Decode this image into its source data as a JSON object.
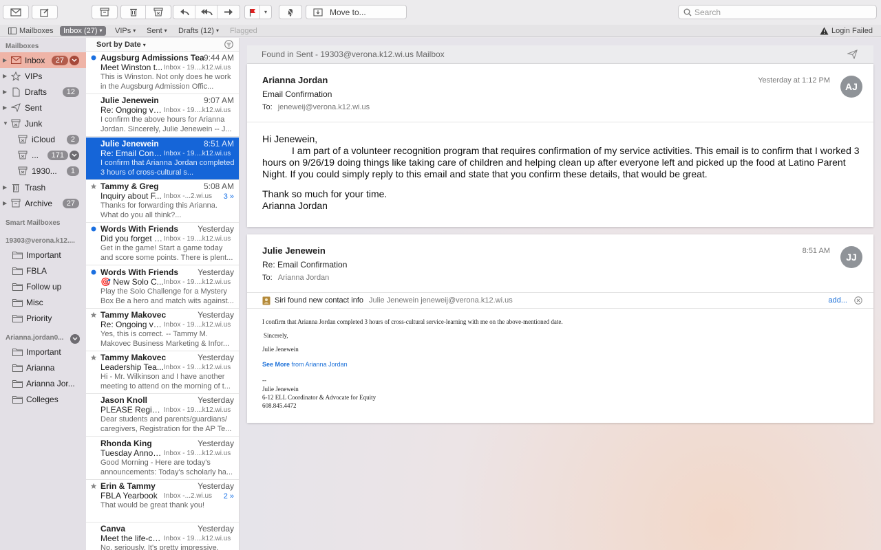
{
  "toolbar": {
    "move_to": "Move to...",
    "search_placeholder": "Search"
  },
  "favorites": {
    "mailboxes": "Mailboxes",
    "inbox": "Inbox (27)",
    "vips": "VIPs",
    "sent": "Sent",
    "drafts": "Drafts (12)",
    "flagged": "Flagged",
    "login_failed": "Login Failed"
  },
  "sidebar": {
    "header_mailboxes": "Mailboxes",
    "inbox": {
      "label": "Inbox",
      "count": "27"
    },
    "vips": {
      "label": "VIPs"
    },
    "drafts": {
      "label": "Drafts",
      "count": "12"
    },
    "sent": {
      "label": "Sent"
    },
    "junk": {
      "label": "Junk"
    },
    "junk_icloud": {
      "label": "iCloud",
      "count": "2"
    },
    "junk_ellipsis": {
      "label": "...",
      "count": "171"
    },
    "junk_1930": {
      "label": "1930...",
      "count": "1"
    },
    "trash": {
      "label": "Trash"
    },
    "archive": {
      "label": "Archive",
      "count": "27"
    },
    "header_smart": "Smart Mailboxes",
    "header_account1": "19303@verona.k12....",
    "account1_folders": [
      "Important",
      "FBLA",
      "Follow up",
      "Misc",
      "Priority"
    ],
    "header_account2": "Arianna.jordan0...",
    "account2_folders": [
      "Important",
      "Arianna",
      "Arianna Jor...",
      "Colleges"
    ]
  },
  "msglist": {
    "sort_label": "Sort by Date",
    "messages": [
      {
        "from": "Augsburg Admissions Team",
        "time": "9:44 AM",
        "subject": "Meet Winston t...",
        "mailbox": "Inbox - 19....k12.wi.us",
        "thread": "",
        "preview": "This is Winston. Not only does he work in the Augsburg Admission Offic...",
        "mark": "unread"
      },
      {
        "from": "Julie Jenewein",
        "time": "9:07 AM",
        "subject": "Re: Ongoing vol...",
        "mailbox": "Inbox - 19....k12.wi.us",
        "thread": "",
        "preview": "I confirm the above hours for Arianna Jordan. Sincerely, Julie Jenewein -- J...",
        "mark": "none"
      },
      {
        "from": "Julie Jenewein",
        "time": "8:51 AM",
        "subject": "Re: Email Confir...",
        "mailbox": "Inbox - 19....k12.wi.us",
        "thread": "",
        "preview": "I confirm that Arianna Jordan completed 3 hours of cross-cultural s...",
        "mark": "none"
      },
      {
        "from": "Tammy & Greg",
        "time": "5:08 AM",
        "subject": "Inquiry about F...",
        "mailbox": "Inbox -...2.wi.us",
        "thread": "3 »",
        "preview": "Thanks for forwarding this Arianna.  What do you all think?...",
        "mark": "star"
      },
      {
        "from": "Words With Friends",
        "time": "Yesterday",
        "subject": "Did you forget a...",
        "mailbox": "Inbox - 19....k12.wi.us",
        "thread": "",
        "preview": "Get in the game! Start a game today and score some points. There is plent...",
        "mark": "unread"
      },
      {
        "from": "Words With Friends",
        "time": "Yesterday",
        "subject": "🎯 New Solo C...",
        "mailbox": "Inbox - 19....k12.wi.us",
        "thread": "",
        "preview": "Play the Solo Challenge for a Mystery Box Be a hero and match wits against...",
        "mark": "unread"
      },
      {
        "from": "Tammy Makovec",
        "time": "Yesterday",
        "subject": "Re: Ongoing vol...",
        "mailbox": "Inbox - 19....k12.wi.us",
        "thread": "",
        "preview": "Yes, this is correct.  -- Tammy M. Makovec Business Marketing & Infor...",
        "mark": "star"
      },
      {
        "from": "Tammy Makovec",
        "time": "Yesterday",
        "subject": "Leadership Tea...",
        "mailbox": "Inbox - 19....k12.wi.us",
        "thread": "",
        "preview": "Hi - Mr. Wilkinson and I have another meeting to attend on the morning of t...",
        "mark": "star"
      },
      {
        "from": "Jason Knoll",
        "time": "Yesterday",
        "subject": "PLEASE Registe...",
        "mailbox": "Inbox - 19....k12.wi.us",
        "thread": "",
        "preview": "Dear students and parents/guardians/ caregivers, Registration for the AP Te...",
        "mark": "none"
      },
      {
        "from": "Rhonda King",
        "time": "Yesterday",
        "subject": "Tuesday Annou...",
        "mailbox": "Inbox - 19....k12.wi.us",
        "thread": "",
        "preview": "Good Morning -  Here are today's announcements: Today's scholarly ha...",
        "mark": "none"
      },
      {
        "from": "Erin & Tammy",
        "time": "Yesterday",
        "subject": "FBLA Yearbook",
        "mailbox": "Inbox -...2.wi.us",
        "thread": "2 »",
        "preview": "That would be great thank you!",
        "mark": "star"
      },
      {
        "from": "Canva",
        "time": "Yesterday",
        "subject": "Meet the life-ch...",
        "mailbox": "Inbox - 19....k12.wi.us",
        "thread": "",
        "preview": "No, seriously. It's pretty impressive.",
        "mark": "none"
      }
    ]
  },
  "reading": {
    "found_bar": "Found in Sent - 19303@verona.k12.wi.us Mailbox",
    "msg1": {
      "from": "Arianna Jordan",
      "subject": "Email Confirmation",
      "to_label": "To:",
      "to": "jeneweij@verona.k12.wi.us",
      "date": "Yesterday at 1:12 PM",
      "initials": "AJ",
      "greeting": "Hi Jenewein,",
      "body": "I am part of a volunteer recognition program that requires confirmation of my service activities. This email is to confirm that I worked  3 hours on 9/26/19 doing things like taking care of children and helping clean up after everyone left and picked up the food at Latino Parent Night. If you could simply reply to this email and state that you confirm these details, that would be great.",
      "thanks": "Thank so much for your time.",
      "signature": "Arianna Jordan"
    },
    "msg2": {
      "from": "Julie Jenewein",
      "subject": "Re: Email Confirmation",
      "to_label": "To:",
      "to": "Arianna Jordan",
      "date": "8:51 AM",
      "initials": "JJ",
      "siri_label": "Siri found new contact info",
      "siri_contact": "Julie Jenewein jeneweij@verona.k12.wi.us",
      "siri_add": "add...",
      "line1": "I confirm that Arianna Jordan completed 3 hours of cross-cultural service-learning with me on the above-mentioned date.",
      "line2": "Sincerely,",
      "line3": "Julie Jenewein",
      "see_more": "See More",
      "see_more_from": "from Arianna Jordan",
      "sig_dash": "--",
      "sig_name": "Julie Jenewein",
      "sig_title": "6-12 ELL Coordinator & Advocate for Equity",
      "sig_phone": "608.845.4472"
    }
  },
  "colors": {
    "selected_row": "#1565d8",
    "sidebar_selected": "#efb4a7",
    "unread_dot": "#1a6fe0",
    "flag": "#e02020"
  }
}
